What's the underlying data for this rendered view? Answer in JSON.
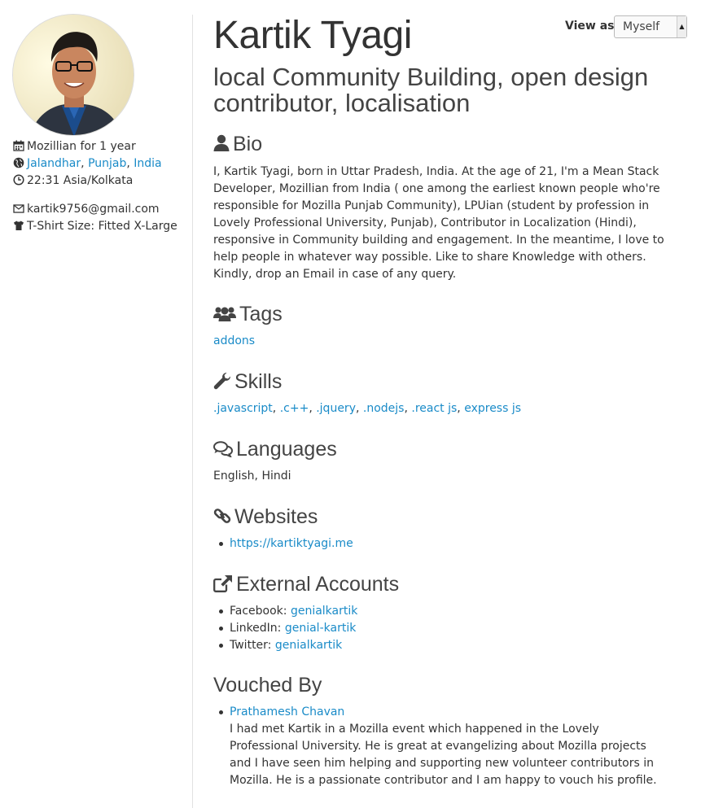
{
  "sidebar": {
    "mozillian_for": "Mozillian for 1 year",
    "location": {
      "city": "Jalandhar",
      "region": "Punjab",
      "country": "India"
    },
    "timezone": "22:31 Asia/Kolkata",
    "email": "kartik9756@gmail.com",
    "tshirt": "T-Shirt Size: Fitted X-Large"
  },
  "profile": {
    "name": "Kartik Tyagi",
    "title": "local Community Building, open design contributor, localisation"
  },
  "view_as": {
    "label": "View as:",
    "selected": "Myself"
  },
  "bio": {
    "heading": "Bio",
    "text": "I, Kartik Tyagi, born in Uttar Pradesh, India. At the age of 21, I'm a Mean Stack Developer, Mozillian from India ( one among the earliest known people who're responsible for Mozilla Punjab Community), LPUian (student by profession in Lovely Professional University, Punjab), Contributor in Localization (Hindi), responsive in Community building and engagement. In the meantime, I love to help people in whatever way possible. Like to share Knowledge with others. Kindly, drop an Email in case of any query."
  },
  "tags": {
    "heading": "Tags",
    "items": [
      "addons"
    ]
  },
  "skills": {
    "heading": "Skills",
    "items": [
      ".javascript",
      ".c++",
      ".jquery",
      ".nodejs",
      ".react js",
      "express js"
    ]
  },
  "languages": {
    "heading": "Languages",
    "text": "English, Hindi"
  },
  "websites": {
    "heading": "Websites",
    "items": [
      "https://kartiktyagi.me"
    ]
  },
  "external_accounts": {
    "heading": "External Accounts",
    "items": [
      {
        "service": "Facebook:",
        "handle": "genialkartik"
      },
      {
        "service": "LinkedIn:",
        "handle": "genial-kartik"
      },
      {
        "service": "Twitter:",
        "handle": "genialkartik"
      }
    ]
  },
  "vouched_by": {
    "heading": "Vouched By",
    "items": [
      {
        "name": "Prathamesh Chavan",
        "text": "I had met Kartik in a Mozilla event which happened in the Lovely Professional University. He is great at evangelizing about Mozilla projects and I have seen him helping and supporting new volunteer contributors in Mozilla. He is a passionate contributor and I am happy to vouch his profile."
      }
    ]
  },
  "icons": {
    "calendar": "calendar-icon",
    "globe": "globe-icon",
    "clock": "clock-icon",
    "envelope": "envelope-icon",
    "tshirt": "tshirt-icon",
    "user": "user-icon",
    "users": "users-icon",
    "wrench": "wrench-icon",
    "comments": "comments-icon",
    "link": "link-icon",
    "external_link": "external-link-icon"
  },
  "colors": {
    "link": "#1a8bc8",
    "text": "#333333",
    "heading": "#444444",
    "divider": "#e2e2e2"
  }
}
